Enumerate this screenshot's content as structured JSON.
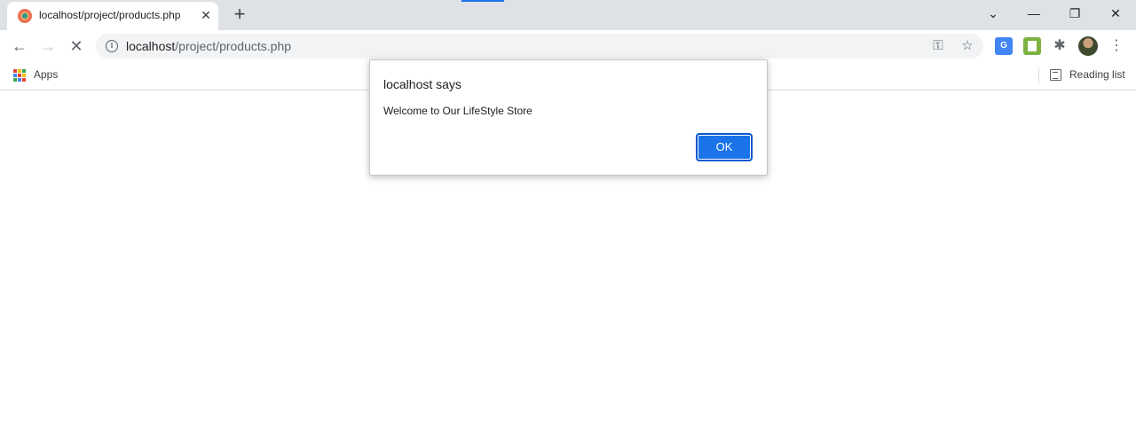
{
  "browser": {
    "tab": {
      "title": "localhost/project/products.php",
      "favicon": "site-favicon",
      "close_glyph": "✕"
    },
    "new_tab_glyph": "+",
    "window_controls": {
      "tab_search": "⌄",
      "minimize": "—",
      "restore": "❐",
      "close": "✕"
    },
    "toolbar": {
      "back_glyph": "←",
      "forward_glyph": "→",
      "reload_glyph": "✕",
      "url_host": "localhost",
      "url_path": "/project/products.php",
      "info_glyph": "i",
      "key_glyph": "⚿",
      "star_glyph": "☆",
      "translate_glyph": "G",
      "puzzle_glyph": "✱",
      "menu_glyph": "⋮"
    },
    "bookmarks": {
      "apps_label": "Apps",
      "reading_list_label": "Reading list",
      "apps_colors": [
        "#ea4335",
        "#fbbc04",
        "#34a853",
        "#4285f4",
        "#ea4335",
        "#fbbc04",
        "#34a853",
        "#4285f4",
        "#ea4335"
      ]
    }
  },
  "alert": {
    "title": "localhost says",
    "message": "Welcome to Our LifeStyle Store",
    "ok_label": "OK"
  },
  "colors": {
    "accent": "#1a73e8",
    "tabstrip": "#dee1e6"
  }
}
